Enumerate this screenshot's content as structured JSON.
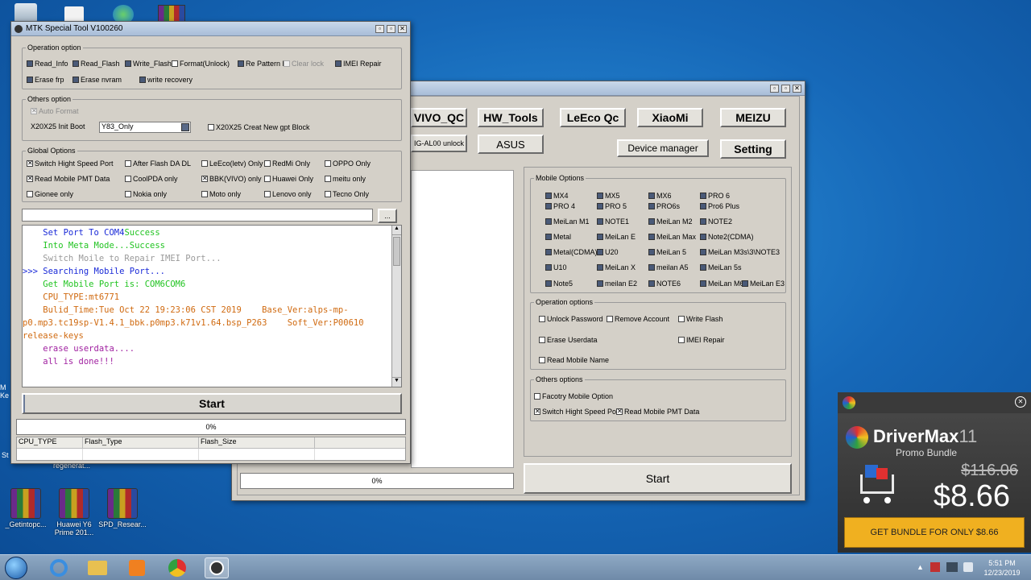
{
  "desktop_icons": [
    {
      "label": "_Getintopc...",
      "kind": "rar"
    },
    {
      "label": "Huawei Y6 Prime 201...",
      "kind": "rar"
    },
    {
      "label": "SPD_Resear...",
      "kind": "rar"
    },
    {
      "label": "regenerat...",
      "kind": "partial"
    }
  ],
  "mtk": {
    "title": "MTK Special Tool V100260",
    "operation_option": {
      "label": "Operation option",
      "items": [
        {
          "label": "Read_Info",
          "checked": false,
          "enabled": true
        },
        {
          "label": "Read_Flash",
          "checked": false,
          "enabled": true
        },
        {
          "label": "Write_Flash",
          "checked": false,
          "enabled": true
        },
        {
          "label": "Format(Unlock)",
          "checked": false,
          "enabled": true
        },
        {
          "label": "Re Pattern M",
          "checked": false,
          "enabled": true
        },
        {
          "label": "Clear lock",
          "checked": false,
          "enabled": false
        },
        {
          "label": "IMEI Repair",
          "checked": false,
          "enabled": true
        },
        {
          "label": "Erase frp",
          "checked": false,
          "enabled": true
        },
        {
          "label": "Erase nvram",
          "checked": false,
          "enabled": true
        },
        {
          "label": "write recovery",
          "checked": false,
          "enabled": true
        }
      ]
    },
    "others_option": {
      "label": "Others option",
      "auto_format": "Auto Format",
      "init_boot_label": "X20X25 Init Boot",
      "init_boot_value": "Y83_Only",
      "creat_gpt": "X20X25 Creat New gpt Block"
    },
    "global_options": {
      "label": "Global Options",
      "items": [
        {
          "label": "Switch Hight Speed Port",
          "checked": true
        },
        {
          "label": "After Flash DA DL",
          "checked": false
        },
        {
          "label": "LeEco(letv) Only",
          "checked": false
        },
        {
          "label": "RedMi Only",
          "checked": false
        },
        {
          "label": "OPPO Only",
          "checked": false
        },
        {
          "label": "Read Mobile PMT Data",
          "checked": true
        },
        {
          "label": "CoolPDA only",
          "checked": false
        },
        {
          "label": "BBK(VIVO) only",
          "checked": true
        },
        {
          "label": "Huawei Only",
          "checked": false
        },
        {
          "label": "meitu only",
          "checked": false
        },
        {
          "label": "Gionee only",
          "checked": false
        },
        {
          "label": "Nokia only",
          "checked": false
        },
        {
          "label": "Moto only",
          "checked": false
        },
        {
          "label": "Lenovo only",
          "checked": false
        },
        {
          "label": "Tecno Only",
          "checked": false
        }
      ]
    },
    "browse_label": "...",
    "log": [
      {
        "text": "    Set Port To COM4",
        "color": "#1a2ad8",
        "tail": "Success",
        "tail_color": "#22c422"
      },
      {
        "text": "    Into Meta Mode...Success",
        "color": "#22c422"
      },
      {
        "text": "    Switch Moile to Repair IMEI Port...",
        "color": "#9a9a9a"
      },
      {
        "text": ">>> Searching Mobile Port...",
        "color": "#1a2ad8"
      },
      {
        "text": "    Get Mobile Port is: COM6COM6",
        "color": "#22c422"
      },
      {
        "text": "    CPU_TYPE:mt6771",
        "color": "#d06a10"
      },
      {
        "text": "    Bulid_Time:Tue Oct 22 19:23:06 CST 2019    Base_Ver:alps-mp-",
        "color": "#d06a10"
      },
      {
        "text": "p0.mp3.tc19sp-V1.4.1_bbk.p0mp3.k71v1.64.bsp_P263    Soft_Ver:P00610",
        "color": "#d06a10"
      },
      {
        "text": "release-keys",
        "color": "#d06a10"
      },
      {
        "text": "    erase userdata....",
        "color": "#a020a0"
      },
      {
        "text": "    all is done!!!",
        "color": "#a020a0"
      }
    ],
    "start_label": "Start",
    "progress": {
      "value": 0,
      "text": "0%"
    },
    "table_headers": [
      "CPU_TYPE",
      "Flash_Type",
      "Flash_Size",
      ""
    ]
  },
  "main": {
    "brand_buttons": [
      {
        "label": "VIVO_QC"
      },
      {
        "label": "HW_Tools"
      },
      {
        "label": "LeEco Qc"
      },
      {
        "label": "XiaoMi"
      },
      {
        "label": "MEIZU"
      }
    ],
    "row2_partial": "IG-AL00 unlock",
    "asus": "ASUS",
    "device_manager": "Device manager",
    "setting": "Setting",
    "mobile_options": {
      "label": "Mobile Options",
      "items": [
        "MX4",
        "MX5",
        "MX6",
        "PRO 6",
        "PRO 4",
        "PRO 5",
        "PRO6s",
        "Pro6 Plus",
        "MeiLan M1",
        "NOTE1",
        "MeiLan M2",
        "NOTE2",
        "Metal",
        "MeiLan E",
        "MeiLan Max",
        "Note2(CDMA)",
        "Metal(CDMA)",
        "U20",
        "MeiLan 5",
        "MeiLan M3s\\3\\NOTE3",
        "U10",
        "MeiLan X",
        "meilan A5",
        "MeiLan 5s",
        "Note5",
        "meilan E2",
        "NOTE6",
        "MeiLan M6",
        "MeiLan E3"
      ]
    },
    "operation_options": {
      "label": "Operation options",
      "items": [
        "Unlock Password",
        "Remove Account",
        "Write Flash",
        "Erase Userdata",
        "IMEI Repair",
        "Read Mobile Name"
      ]
    },
    "others_options": {
      "label": "Others options",
      "items": [
        {
          "label": "Facotry Mobile Option",
          "checked": false
        },
        {
          "label": "Switch Hight Speed Por",
          "checked": true
        },
        {
          "label": "Read Mobile PMT Data",
          "checked": true
        }
      ]
    },
    "progress": {
      "value": 0,
      "text": "0%"
    },
    "start_label": "Start"
  },
  "ad": {
    "brand": "DriverMax",
    "version": "11",
    "subtitle": "Promo Bundle",
    "old_price": "$116.06",
    "new_price": "$8.66",
    "cta": "GET BUNDLE FOR ONLY $8.66",
    "close": "✕"
  },
  "taskbar": {
    "time": "5:51 PM",
    "date": "12/23/2019"
  },
  "colors": {
    "desktop": "#1668b8",
    "window_face": "#d4d0c8",
    "ad_cta": "#f0b020"
  }
}
